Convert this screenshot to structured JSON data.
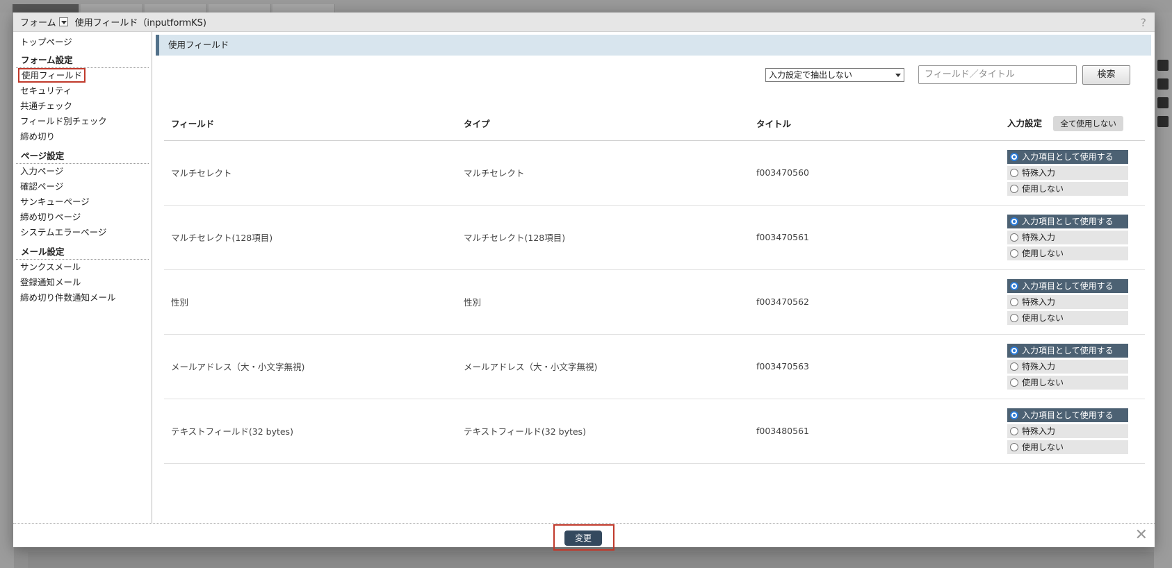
{
  "header": {
    "menu_label": "フォーム",
    "title": "使用フィールド（inputformKS)",
    "help": "?"
  },
  "sidebar": {
    "top_page": "トップページ",
    "groups": [
      {
        "heading": "フォーム設定",
        "items": [
          "使用フィールド",
          "セキュリティ",
          "共通チェック",
          "フィールド別チェック",
          "締め切り"
        ]
      },
      {
        "heading": "ページ設定",
        "items": [
          "入力ページ",
          "確認ページ",
          "サンキューページ",
          "締め切りページ",
          "システムエラーページ"
        ]
      },
      {
        "heading": "メール設定",
        "items": [
          "サンクスメール",
          "登録通知メール",
          "締め切り件数通知メール"
        ]
      }
    ],
    "selected": "使用フィールド"
  },
  "content": {
    "title": "使用フィールド",
    "filter_select": "入力設定で抽出しない",
    "search_placeholder": "フィールド／タイトル",
    "search_button": "検索"
  },
  "table": {
    "headers": {
      "field": "フィールド",
      "type": "タイプ",
      "title": "タイトル",
      "input_setting": "入力設定",
      "all_off_button": "全て使用しない"
    },
    "radio_labels": [
      "入力項目として使用する",
      "特殊入力",
      "使用しない"
    ],
    "rows": [
      {
        "field": "マルチセレクト",
        "type": "マルチセレクト",
        "title": "f003470560",
        "selected": 0
      },
      {
        "field": "マルチセレクト(128項目)",
        "type": "マルチセレクト(128項目)",
        "title": "f003470561",
        "selected": 0
      },
      {
        "field": "性別",
        "type": "性別",
        "title": "f003470562",
        "selected": 0
      },
      {
        "field": "メールアドレス（大・小文字無視)",
        "type": "メールアドレス（大・小文字無視)",
        "title": "f003470563",
        "selected": 0
      },
      {
        "field": "テキストフィールド(32 bytes)",
        "type": "テキストフィールド(32 bytes)",
        "title": "f003480561",
        "selected": 0
      }
    ]
  },
  "footer": {
    "change_button": "変更",
    "close": "✕"
  },
  "colors": {
    "accent": "#4c6173",
    "highlight_frame": "#c0392b",
    "title_bar": "#d8e5ee"
  }
}
